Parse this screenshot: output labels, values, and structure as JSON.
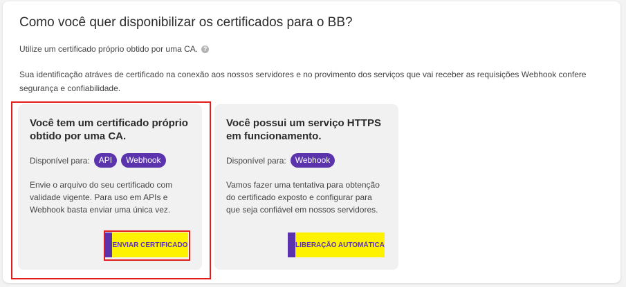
{
  "header": {
    "title": "Como você quer disponibilizar os certificados para o BB?",
    "subtitle": "Utilize um certificado próprio obtido por uma CA.",
    "help_icon": "?",
    "description": "Sua identificação atráves de certificado na conexão aos nossos servidores e no provimento dos serviços que vai receber as requisições Webhook confere segurança e confiabilidade."
  },
  "cards": [
    {
      "title": "Você tem um certificado próprio obtido por uma CA.",
      "available_label": "Disponível para:",
      "tags": [
        "API",
        "Webhook"
      ],
      "text": "Envie o arquivo do seu certificado com validade vigente. Para uso em APIs e Webhook basta enviar uma única vez.",
      "button_label": "ENVIAR CERTIFICADO"
    },
    {
      "title": "Você possui um serviço HTTPS em funcionamento.",
      "available_label": "Disponível para:",
      "tags": [
        "Webhook"
      ],
      "text": "Vamos fazer uma tentativa para obtenção do certificado exposto e configurar para que seja confiável em nossos servidores.",
      "button_label": "LIBERAÇÃO AUTOMÁTICA"
    }
  ],
  "colors": {
    "accent_purple": "#5b34ad",
    "accent_yellow": "#fff200",
    "highlight_red": "#e21b1b"
  }
}
